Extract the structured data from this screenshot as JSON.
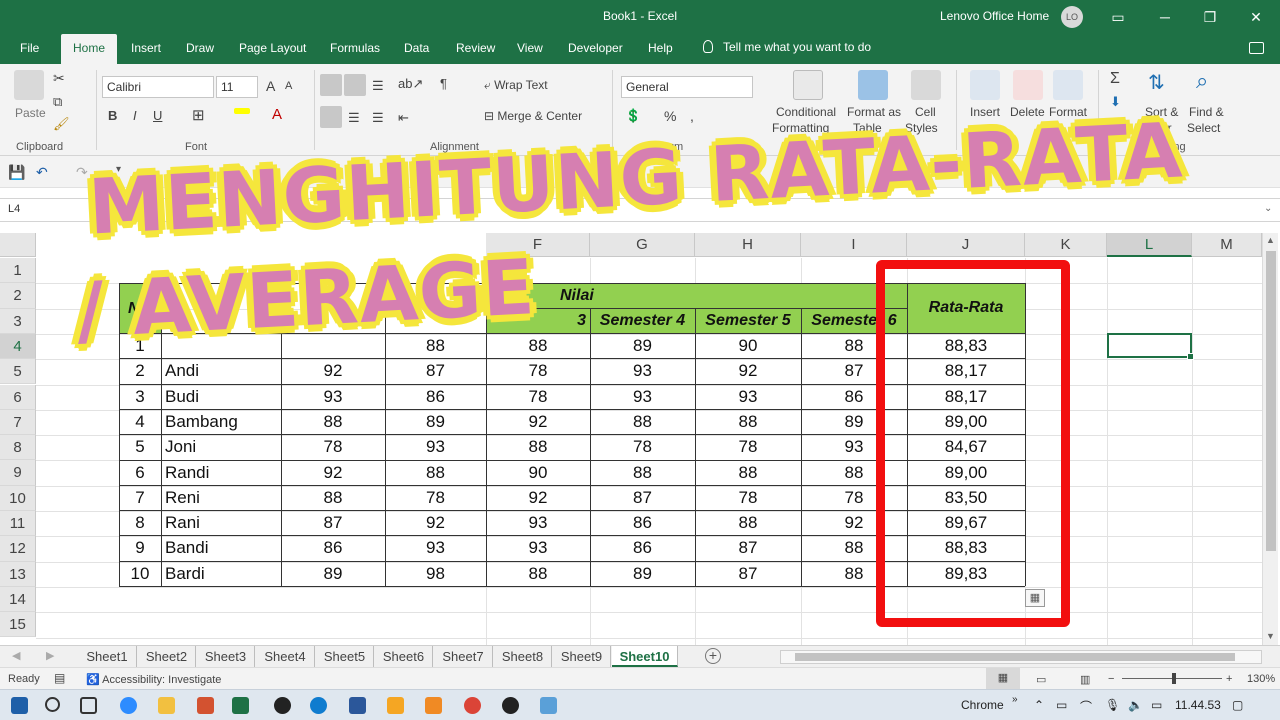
{
  "window": {
    "title": "Book1  -  Excel",
    "account": "Lenovo Office Home",
    "avatar": "LO"
  },
  "menu": {
    "tabs": [
      "File",
      "Home",
      "Insert",
      "Draw",
      "Page Layout",
      "Formulas",
      "Data",
      "Review",
      "View",
      "Developer",
      "Help"
    ],
    "active_tab": "Home",
    "tell_me": "Tell me what you want to do"
  },
  "ribbon": {
    "clipboard": {
      "paste": "Paste",
      "label": "Clipboard"
    },
    "font": {
      "name": "Calibri",
      "size": "11",
      "label": "Font"
    },
    "alignment": {
      "wrap_text": "Wrap Text",
      "merge_center": "Merge & Center",
      "label": "Alignment"
    },
    "number": {
      "format": "General",
      "label": "Num"
    },
    "styles": {
      "conditional_1": "Conditional",
      "conditional_2": "Formatting",
      "format_as_1": "Format as",
      "format_as_2": "Table",
      "cell_1": "Cell",
      "cell_2": "Styles"
    },
    "cells": {
      "insert": "Insert",
      "delete": "Delete",
      "format": "Format"
    },
    "editing": {
      "sort_1": "Sort &",
      "sort_2": "Filter",
      "find_1": "Find &",
      "find_2": "Select",
      "label": "Editing"
    }
  },
  "name_box": "L4",
  "overlay": {
    "line1": "MENGHITUNG  RATA-RATA",
    "line2": "/  AVERAGE"
  },
  "columns": {
    "visible": [
      "F",
      "G",
      "H",
      "I",
      "J",
      "K",
      "L",
      "M"
    ],
    "selected": "L"
  },
  "rows": {
    "numbers": [
      "1",
      "2",
      "3",
      "4",
      "5",
      "6",
      "7",
      "8",
      "9",
      "10",
      "11",
      "12",
      "13",
      "14",
      "15"
    ],
    "selected": "4"
  },
  "table": {
    "header_group": "Nilai",
    "header_no": "No",
    "header_partial_semester": "3",
    "semester_headers": [
      "Semester 4",
      "Semester 5",
      "Semester 6"
    ],
    "average_header": "Rata-Rata",
    "rows": [
      {
        "no": "1",
        "name": "",
        "s1": "",
        "s2": "88",
        "s3": "88",
        "s4": "89",
        "s5": "90",
        "s6": "88",
        "avg": "88,83"
      },
      {
        "no": "2",
        "name": "Andi",
        "s1": "92",
        "s2": "87",
        "s3": "78",
        "s4": "93",
        "s5": "92",
        "s6": "87",
        "avg": "88,17"
      },
      {
        "no": "3",
        "name": "Budi",
        "s1": "93",
        "s2": "86",
        "s3": "78",
        "s4": "93",
        "s5": "93",
        "s6": "86",
        "avg": "88,17"
      },
      {
        "no": "4",
        "name": "Bambang",
        "s1": "88",
        "s2": "89",
        "s3": "92",
        "s4": "88",
        "s5": "88",
        "s6": "89",
        "avg": "89,00"
      },
      {
        "no": "5",
        "name": "Joni",
        "s1": "78",
        "s2": "93",
        "s3": "88",
        "s4": "78",
        "s5": "78",
        "s6": "93",
        "avg": "84,67"
      },
      {
        "no": "6",
        "name": "Randi",
        "s1": "92",
        "s2": "88",
        "s3": "90",
        "s4": "88",
        "s5": "88",
        "s6": "88",
        "avg": "89,00"
      },
      {
        "no": "7",
        "name": "Reni",
        "s1": "88",
        "s2": "78",
        "s3": "92",
        "s4": "87",
        "s5": "78",
        "s6": "78",
        "avg": "83,50"
      },
      {
        "no": "8",
        "name": "Rani",
        "s1": "87",
        "s2": "92",
        "s3": "93",
        "s4": "86",
        "s5": "88",
        "s6": "92",
        "avg": "89,67"
      },
      {
        "no": "9",
        "name": "Bandi",
        "s1": "86",
        "s2": "93",
        "s3": "93",
        "s4": "86",
        "s5": "87",
        "s6": "88",
        "avg": "88,83"
      },
      {
        "no": "10",
        "name": "Bardi",
        "s1": "89",
        "s2": "98",
        "s3": "88",
        "s4": "89",
        "s5": "87",
        "s6": "88",
        "avg": "89,83"
      }
    ]
  },
  "sheets": [
    "Sheet1",
    "Sheet2",
    "Sheet3",
    "Sheet4",
    "Sheet5",
    "Sheet6",
    "Sheet7",
    "Sheet8",
    "Sheet9",
    "Sheet10"
  ],
  "active_sheet": "Sheet10",
  "status": {
    "ready": "Ready",
    "accessibility": "Accessibility: Investigate",
    "zoom": "130%"
  },
  "taskbar": {
    "chrome_label": "Chrome",
    "time": "11.44.53"
  },
  "colors": {
    "excel_green": "#1e7145",
    "header_fill": "#92d050",
    "highlight_box": "#f20f0f",
    "overlay_fill": "#d67fb1",
    "overlay_outline": "#f5e63c"
  }
}
